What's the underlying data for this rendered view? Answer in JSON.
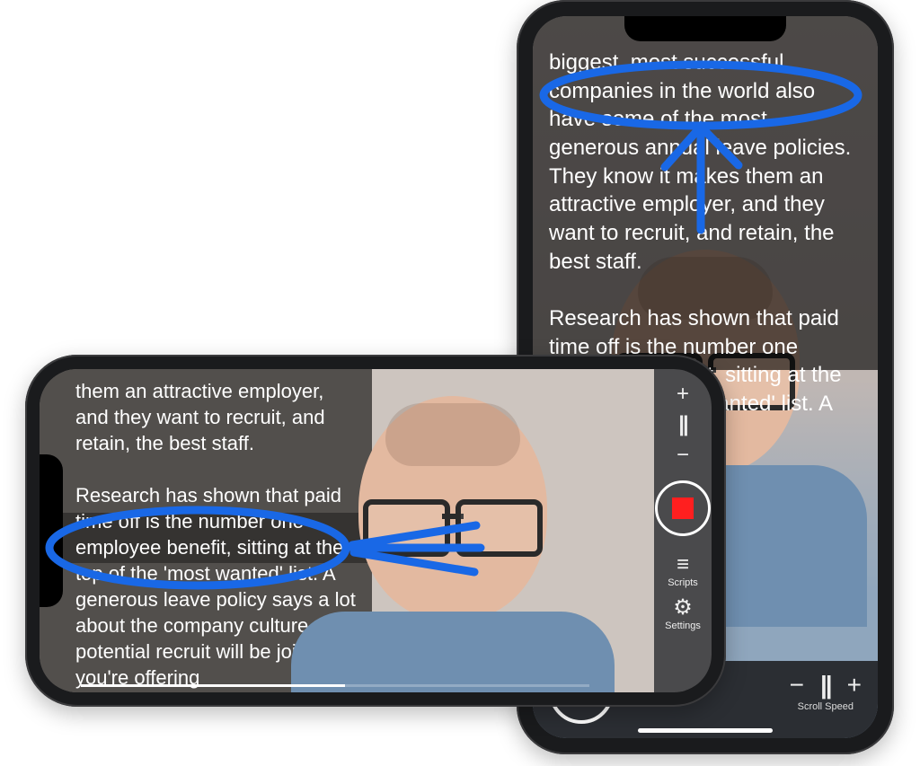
{
  "portrait": {
    "teleprompter_text": "biggest, most successful companies in the world also have some of the most generous annual leave policies. They know it makes them an attractive employer, and they want to recruit, and retain, the best staff.\n\nResearch has shown that paid time off is the number one employee benefit, sitting at the top of the 'most wanted' list. A",
    "scroll_speed_label": "Scroll Speed",
    "scroll_minus": "−",
    "scroll_pause": "||",
    "scroll_plus": "+"
  },
  "landscape": {
    "teleprompter_text": "them an attractive employer, and they want to recruit, and retain, the best staff.\n\nResearch has shown that paid time off is the number one employee benefit, sitting at the top of the 'most wanted' list. A generous leave policy says a lot about the company culture a potential recruit will be joining. If you're offering",
    "speed_plus": "+",
    "speed_pause": "||",
    "speed_minus": "−",
    "scripts_label": "Scripts",
    "settings_label": "Settings"
  },
  "annotations": {
    "portrait_highlight": "focus line circled with arrow",
    "landscape_highlight": "focus line circled with arrow"
  }
}
